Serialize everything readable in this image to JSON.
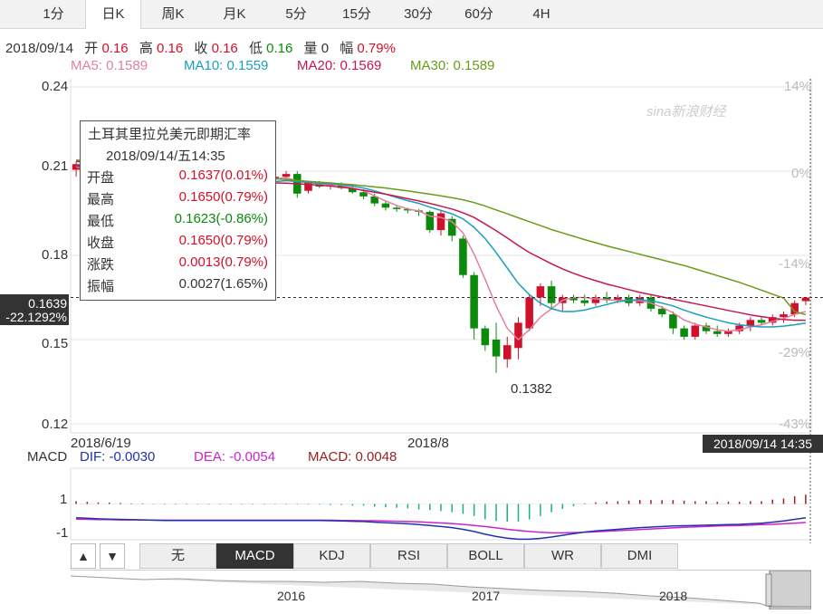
{
  "tabs": [
    "1分",
    "日K",
    "周K",
    "月K",
    "5分",
    "15分",
    "30分",
    "60分",
    "4H"
  ],
  "active_tab": "日K",
  "quote": {
    "date": "2018/09/14",
    "open_label": "开",
    "open": "0.16",
    "high_label": "高",
    "high": "0.16",
    "close_label": "收",
    "close": "0.16",
    "low_label": "低",
    "low": "0.16",
    "volume_label": "量",
    "volume": "0",
    "amp_label": "幅",
    "amp": "0.79%"
  },
  "ma": {
    "ma5": "MA5: 0.1589",
    "ma10": "MA10: 0.1559",
    "ma20": "MA20: 0.1569",
    "ma30": "MA30: 0.1589"
  },
  "colors": {
    "up": "#d0112b",
    "down": "#0b8a0b",
    "ma5": "#e37f9e",
    "ma10": "#1a9fc0",
    "ma20": "#c8174f",
    "ma30": "#6a9b1a",
    "dif": "#2233aa",
    "dea": "#cc22cc"
  },
  "watermark": "sina新浪财经",
  "y_axis_left": [
    "0.24",
    "0.21",
    "0.18",
    "0.15",
    "0.12"
  ],
  "y_axis_right": [
    "14%",
    "0%",
    "-14%",
    "-29%",
    "-43%"
  ],
  "price_tag": {
    "price": "0.1639",
    "pct": "-22.1292%"
  },
  "low_label": "0.1382",
  "x_axis": [
    "2018/6/19",
    "2018/8"
  ],
  "time_tag": "2018/09/14 14:35",
  "tooltip": {
    "title": "土耳其里拉兑美元即期汇率",
    "time": "2018/09/14/五14:35",
    "rows": [
      {
        "k": "开盘",
        "v": "0.1637(0.01%)",
        "c": "up"
      },
      {
        "k": "最高",
        "v": "0.1650(0.79%)",
        "c": "up"
      },
      {
        "k": "最低",
        "v": "0.1623(-0.86%)",
        "c": "down"
      },
      {
        "k": "收盘",
        "v": "0.1650(0.79%)",
        "c": "up"
      },
      {
        "k": "涨跌",
        "v": "0.0013(0.79%)",
        "c": "up"
      },
      {
        "k": "振幅",
        "v": "0.0027(1.65%)",
        "c": "plain"
      }
    ]
  },
  "macd": {
    "label": "MACD",
    "dif": "DIF: -0.0030",
    "dea": "DEA: -0.0054",
    "macd": "MACD: 0.0048",
    "y_labels": [
      "1",
      "-1"
    ]
  },
  "indicators": [
    "无",
    "MACD",
    "KDJ",
    "RSI",
    "BOLL",
    "WR",
    "DMI"
  ],
  "active_indicator": "MACD",
  "arrows": [
    "▲",
    "▼"
  ],
  "navigator_years": [
    "2016",
    "2017",
    "2018"
  ],
  "chart_data": {
    "type": "candlestick",
    "title": "土耳其里拉兑美元即期汇率",
    "ylim": [
      0.12,
      0.24
    ],
    "ohlc": [
      [
        0.2105,
        0.2135,
        0.208,
        0.2125
      ],
      [
        0.211,
        0.214,
        0.209,
        0.21
      ],
      [
        0.2095,
        0.212,
        0.207,
        0.208
      ],
      [
        0.208,
        0.211,
        0.206,
        0.2095
      ],
      [
        0.209,
        0.21,
        0.204,
        0.205
      ],
      [
        0.2055,
        0.209,
        0.2045,
        0.208
      ],
      [
        0.2075,
        0.2085,
        0.204,
        0.205
      ],
      [
        0.205,
        0.207,
        0.203,
        0.204
      ],
      [
        0.204,
        0.208,
        0.203,
        0.207
      ],
      [
        0.2065,
        0.2075,
        0.2045,
        0.206
      ],
      [
        0.206,
        0.207,
        0.204,
        0.2055
      ],
      [
        0.205,
        0.206,
        0.203,
        0.2045
      ],
      [
        0.2045,
        0.206,
        0.2035,
        0.204
      ],
      [
        0.204,
        0.2065,
        0.203,
        0.206
      ],
      [
        0.206,
        0.208,
        0.205,
        0.207
      ],
      [
        0.2065,
        0.208,
        0.205,
        0.2055
      ],
      [
        0.206,
        0.2075,
        0.205,
        0.207
      ],
      [
        0.207,
        0.2085,
        0.206,
        0.2075
      ],
      [
        0.2075,
        0.209,
        0.2065,
        0.208
      ],
      [
        0.208,
        0.21,
        0.207,
        0.209
      ],
      [
        0.209,
        0.21,
        0.2005,
        0.202
      ],
      [
        0.203,
        0.2065,
        0.202,
        0.206
      ],
      [
        0.2055,
        0.2065,
        0.204,
        0.2045
      ],
      [
        0.2045,
        0.206,
        0.2035,
        0.205
      ],
      [
        0.205,
        0.206,
        0.2035,
        0.204
      ],
      [
        0.204,
        0.205,
        0.202,
        0.2025
      ],
      [
        0.2025,
        0.2035,
        0.2,
        0.201
      ],
      [
        0.201,
        0.202,
        0.1975,
        0.1985
      ],
      [
        0.1985,
        0.1995,
        0.196,
        0.197
      ],
      [
        0.197,
        0.198,
        0.1955,
        0.1965
      ],
      [
        0.1965,
        0.197,
        0.195,
        0.196
      ],
      [
        0.196,
        0.1965,
        0.194,
        0.1955
      ],
      [
        0.1955,
        0.196,
        0.188,
        0.189
      ],
      [
        0.189,
        0.196,
        0.187,
        0.195
      ],
      [
        0.193,
        0.194,
        0.185,
        0.187
      ],
      [
        0.186,
        0.187,
        0.172,
        0.173
      ],
      [
        0.173,
        0.174,
        0.15,
        0.154
      ],
      [
        0.154,
        0.155,
        0.146,
        0.148
      ],
      [
        0.15,
        0.156,
        0.1382,
        0.144
      ],
      [
        0.143,
        0.151,
        0.14,
        0.148
      ],
      [
        0.147,
        0.158,
        0.143,
        0.156
      ],
      [
        0.154,
        0.166,
        0.153,
        0.165
      ],
      [
        0.165,
        0.17,
        0.162,
        0.169
      ],
      [
        0.169,
        0.171,
        0.161,
        0.163
      ],
      [
        0.163,
        0.166,
        0.16,
        0.165
      ],
      [
        0.165,
        0.166,
        0.163,
        0.164
      ],
      [
        0.164,
        0.166,
        0.162,
        0.163
      ],
      [
        0.163,
        0.166,
        0.162,
        0.165
      ],
      [
        0.165,
        0.167,
        0.163,
        0.164
      ],
      [
        0.164,
        0.166,
        0.163,
        0.165
      ],
      [
        0.165,
        0.166,
        0.162,
        0.163
      ],
      [
        0.163,
        0.166,
        0.162,
        0.165
      ],
      [
        0.165,
        0.166,
        0.16,
        0.161
      ],
      [
        0.161,
        0.162,
        0.158,
        0.159
      ],
      [
        0.159,
        0.16,
        0.152,
        0.154
      ],
      [
        0.154,
        0.155,
        0.15,
        0.151
      ],
      [
        0.151,
        0.156,
        0.15,
        0.155
      ],
      [
        0.155,
        0.156,
        0.152,
        0.153
      ],
      [
        0.153,
        0.155,
        0.151,
        0.152
      ],
      [
        0.152,
        0.154,
        0.151,
        0.153
      ],
      [
        0.153,
        0.156,
        0.152,
        0.155
      ],
      [
        0.155,
        0.158,
        0.153,
        0.157
      ],
      [
        0.157,
        0.158,
        0.155,
        0.156
      ],
      [
        0.156,
        0.159,
        0.155,
        0.158
      ],
      [
        0.158,
        0.16,
        0.156,
        0.159
      ],
      [
        0.159,
        0.164,
        0.158,
        0.163
      ],
      [
        0.1637,
        0.165,
        0.1623,
        0.165
      ]
    ],
    "ma_series": [
      {
        "name": "MA5",
        "values": [
          0.2115,
          0.2105,
          0.2098,
          0.2085,
          0.2075,
          0.207,
          0.2065,
          0.2058,
          0.2055,
          0.2058,
          0.206,
          0.2057,
          0.2053,
          0.2053,
          0.2055,
          0.2058,
          0.2062,
          0.2068,
          0.2072,
          0.2077,
          0.2065,
          0.206,
          0.2055,
          0.2052,
          0.205,
          0.204,
          0.203,
          0.2012,
          0.1994,
          0.1978,
          0.1965,
          0.1958,
          0.194,
          0.1935,
          0.192,
          0.188,
          0.1805,
          0.1715,
          0.162,
          0.154,
          0.15,
          0.1535,
          0.158,
          0.161,
          0.164,
          0.165,
          0.165,
          0.1645,
          0.1642,
          0.164,
          0.164,
          0.1638,
          0.163,
          0.1615,
          0.1595,
          0.157,
          0.1555,
          0.1545,
          0.1535,
          0.153,
          0.1535,
          0.1545,
          0.1553,
          0.1565,
          0.1575,
          0.159,
          0.16
        ]
      },
      {
        "name": "MA10",
        "values": [
          0.2125,
          0.2118,
          0.211,
          0.21,
          0.2092,
          0.2085,
          0.2078,
          0.2072,
          0.2066,
          0.2062,
          0.2059,
          0.2056,
          0.2054,
          0.2054,
          0.2055,
          0.2057,
          0.2058,
          0.206,
          0.2063,
          0.2066,
          0.2063,
          0.206,
          0.2057,
          0.2055,
          0.2052,
          0.2047,
          0.204,
          0.203,
          0.2018,
          0.2006,
          0.1995,
          0.1985,
          0.1972,
          0.196,
          0.1948,
          0.193,
          0.19,
          0.186,
          0.181,
          0.1755,
          0.17,
          0.166,
          0.163,
          0.161,
          0.16,
          0.16,
          0.1605,
          0.1615,
          0.1625,
          0.1635,
          0.164,
          0.1642,
          0.1638,
          0.163,
          0.162,
          0.1605,
          0.1592,
          0.158,
          0.157,
          0.156,
          0.1553,
          0.1548,
          0.1545,
          0.1545,
          0.1548,
          0.1553,
          0.1559
        ]
      },
      {
        "name": "MA20",
        "values": [
          0.2135,
          0.213,
          0.2125,
          0.212,
          0.2115,
          0.211,
          0.2104,
          0.2098,
          0.2092,
          0.2087,
          0.2082,
          0.2078,
          0.2074,
          0.207,
          0.2067,
          0.2064,
          0.2061,
          0.2059,
          0.2058,
          0.2057,
          0.2055,
          0.2053,
          0.205,
          0.2047,
          0.2043,
          0.2038,
          0.2032,
          0.2025,
          0.2018,
          0.201,
          0.2002,
          0.1994,
          0.1985,
          0.1975,
          0.1965,
          0.1952,
          0.1935,
          0.1912,
          0.1888,
          0.1862,
          0.1835,
          0.181,
          0.179,
          0.177,
          0.1752,
          0.1736,
          0.1722,
          0.171,
          0.1698,
          0.1688,
          0.1678,
          0.1668,
          0.166,
          0.1652,
          0.1644,
          0.1636,
          0.1628,
          0.162,
          0.1612,
          0.1604,
          0.1596,
          0.1588,
          0.1582,
          0.1576,
          0.1572,
          0.1569,
          0.1569
        ]
      },
      {
        "name": "MA30",
        "values": [
          0.214,
          0.2136,
          0.2132,
          0.2128,
          0.2124,
          0.212,
          0.2116,
          0.2112,
          0.2108,
          0.2104,
          0.21,
          0.2096,
          0.2092,
          0.2088,
          0.2085,
          0.2082,
          0.2079,
          0.2076,
          0.2073,
          0.207,
          0.2067,
          0.2064,
          0.2061,
          0.2058,
          0.2055,
          0.2052,
          0.2048,
          0.2044,
          0.204,
          0.2035,
          0.203,
          0.2024,
          0.2018,
          0.2012,
          0.2005,
          0.1998,
          0.1988,
          0.1976,
          0.1962,
          0.1948,
          0.1934,
          0.192,
          0.1906,
          0.1892,
          0.188,
          0.1868,
          0.1856,
          0.1845,
          0.1834,
          0.1824,
          0.1814,
          0.1804,
          0.1794,
          0.1784,
          0.1774,
          0.1764,
          0.1752,
          0.174,
          0.1728,
          0.1716,
          0.1704,
          0.169,
          0.1676,
          0.1662,
          0.1648,
          0.16,
          0.1589
        ]
      }
    ],
    "macd_series": {
      "ylim": [
        -1.3,
        1.3
      ],
      "dif": [
        -0.5,
        -0.52,
        -0.54,
        -0.55,
        -0.56,
        -0.57,
        -0.58,
        -0.59,
        -0.6,
        -0.6,
        -0.6,
        -0.6,
        -0.6,
        -0.6,
        -0.6,
        -0.6,
        -0.6,
        -0.6,
        -0.6,
        -0.6,
        -0.6,
        -0.6,
        -0.6,
        -0.61,
        -0.62,
        -0.63,
        -0.64,
        -0.66,
        -0.68,
        -0.7,
        -0.72,
        -0.75,
        -0.78,
        -0.82,
        -0.86,
        -0.92,
        -1.0,
        -1.1,
        -1.18,
        -1.24,
        -1.28,
        -1.28,
        -1.25,
        -1.2,
        -1.14,
        -1.08,
        -1.02,
        -0.98,
        -0.95,
        -0.92,
        -0.89,
        -0.86,
        -0.84,
        -0.82,
        -0.8,
        -0.79,
        -0.78,
        -0.77,
        -0.76,
        -0.75,
        -0.74,
        -0.72,
        -0.7,
        -0.66,
        -0.62,
        -0.56,
        -0.5
      ],
      "dea": [
        -0.55,
        -0.56,
        -0.57,
        -0.57,
        -0.58,
        -0.58,
        -0.58,
        -0.59,
        -0.59,
        -0.59,
        -0.59,
        -0.59,
        -0.59,
        -0.59,
        -0.59,
        -0.59,
        -0.59,
        -0.59,
        -0.59,
        -0.59,
        -0.59,
        -0.59,
        -0.59,
        -0.59,
        -0.6,
        -0.6,
        -0.61,
        -0.61,
        -0.62,
        -0.63,
        -0.64,
        -0.65,
        -0.67,
        -0.69,
        -0.71,
        -0.74,
        -0.78,
        -0.82,
        -0.87,
        -0.92,
        -0.96,
        -1.0,
        -1.03,
        -1.05,
        -1.05,
        -1.04,
        -1.03,
        -1.01,
        -0.99,
        -0.97,
        -0.95,
        -0.93,
        -0.91,
        -0.89,
        -0.87,
        -0.85,
        -0.83,
        -0.82,
        -0.8,
        -0.79,
        -0.78,
        -0.77,
        -0.75,
        -0.74,
        -0.72,
        -0.7,
        -0.67
      ],
      "hist": [
        0.1,
        0.08,
        0.06,
        0.05,
        0.04,
        0.02,
        0.02,
        0.01,
        -0.02,
        -0.02,
        -0.02,
        -0.02,
        -0.02,
        -0.02,
        -0.02,
        -0.02,
        -0.02,
        -0.02,
        -0.02,
        -0.02,
        -0.02,
        -0.02,
        -0.02,
        -0.04,
        -0.04,
        -0.06,
        -0.06,
        -0.1,
        -0.12,
        -0.14,
        -0.16,
        -0.2,
        -0.22,
        -0.26,
        -0.3,
        -0.36,
        -0.44,
        -0.56,
        -0.62,
        -0.64,
        -0.64,
        -0.56,
        -0.44,
        -0.3,
        -0.18,
        -0.08,
        0.02,
        0.06,
        0.08,
        0.1,
        0.12,
        0.14,
        0.14,
        0.14,
        0.14,
        0.12,
        0.1,
        0.1,
        0.08,
        0.08,
        0.08,
        0.1,
        0.1,
        0.16,
        0.2,
        0.28,
        0.34
      ]
    }
  }
}
